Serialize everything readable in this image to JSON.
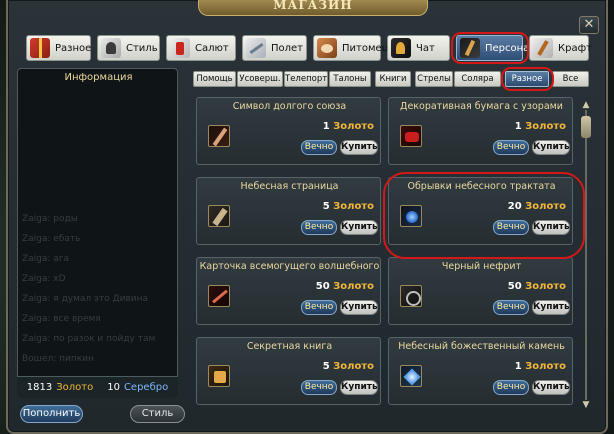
{
  "window": {
    "title": "МАГАЗИН",
    "close_label": "✕"
  },
  "categories": [
    {
      "label": "Разное",
      "icon": "gift-icon"
    },
    {
      "label": "Стиль",
      "icon": "style-icon"
    },
    {
      "label": "Салют",
      "icon": "salute-icon"
    },
    {
      "label": "Полет",
      "icon": "flight-icon"
    },
    {
      "label": "Питомец",
      "icon": "pet-icon"
    },
    {
      "label": "Чат",
      "icon": "chat-icon"
    },
    {
      "label": "Персонаж",
      "icon": "character-icon",
      "active": true
    },
    {
      "label": "Крафт",
      "icon": "craft-icon"
    }
  ],
  "info": {
    "title": "Информация",
    "background_chat": [
      "Zaiga: роды",
      "Zaiga: ебать",
      "Zaiga: ага",
      "Zaiga: хD",
      "Zaiga: я думал это Дивина",
      "Zaiga: все время",
      "Zaiga: по разок и пойду там",
      "Вошел: пипкин"
    ]
  },
  "balance": {
    "gold_amount": "1813",
    "gold_label": "Золото",
    "silver_amount": "10",
    "silver_label": "Серебро"
  },
  "buttons": {
    "topup": "Пополнить",
    "style": "Стиль"
  },
  "subcategories": [
    {
      "label": "Помощь"
    },
    {
      "label": "Усоверш."
    },
    {
      "label": "Телепорт"
    },
    {
      "label": "Талоны"
    },
    {
      "label": "Книги"
    },
    {
      "label": "Стрелы"
    },
    {
      "label": "Соляра"
    },
    {
      "label": "Разное",
      "active": true
    },
    {
      "label": "Все"
    }
  ],
  "items": [
    {
      "name": "Символ долгого союза",
      "price": "1",
      "currency": "Золото",
      "forever": "Вечно",
      "buy": "Купить",
      "icon": "lance-icon"
    },
    {
      "name": "Декоративная бумага с узорами",
      "price": "1",
      "currency": "Золото",
      "forever": "Вечно",
      "buy": "Купить",
      "icon": "red-paper-icon"
    },
    {
      "name": "Небесная страница",
      "price": "5",
      "currency": "Золото",
      "forever": "Вечно",
      "buy": "Купить",
      "icon": "page-icon"
    },
    {
      "name": "Обрывки небесного трактата",
      "price": "20",
      "currency": "Золото",
      "forever": "Вечно",
      "buy": "Купить",
      "icon": "fragment-icon"
    },
    {
      "name": "Карточка всемогущего волшебного",
      "price": "50",
      "currency": "Золото",
      "forever": "Вечно",
      "buy": "Купить",
      "icon": "card-icon"
    },
    {
      "name": "Черный нефрит",
      "price": "50",
      "currency": "Золото",
      "forever": "Вечно",
      "buy": "Купить",
      "icon": "jade-icon"
    },
    {
      "name": "Секретная книга",
      "price": "5",
      "currency": "Золото",
      "forever": "Вечно",
      "buy": "Купить",
      "icon": "book-icon"
    },
    {
      "name": "Небесный божественный камень",
      "price": "1",
      "currency": "Золото",
      "forever": "Вечно",
      "buy": "Купить",
      "icon": "stone-icon"
    }
  ],
  "colors": {
    "gold_text": "#f2b63a",
    "silver_text": "#7fb6ff",
    "item_name": "#ead9a0",
    "annotation_red": "#d41818",
    "active_tab": "#2e4d74"
  }
}
